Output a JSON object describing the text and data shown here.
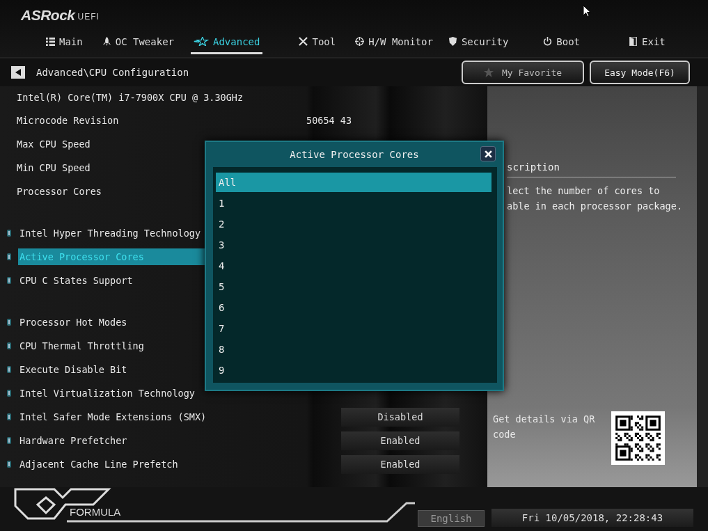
{
  "logo": {
    "brand": "ASRock",
    "suffix": "UEFI"
  },
  "tabs": [
    {
      "label": "Main",
      "selected": false
    },
    {
      "label": "OC Tweaker",
      "selected": false
    },
    {
      "label": "Advanced",
      "selected": true
    },
    {
      "label": "Tool",
      "selected": false
    },
    {
      "label": "H/W Monitor",
      "selected": false
    },
    {
      "label": "Security",
      "selected": false
    },
    {
      "label": "Boot",
      "selected": false
    },
    {
      "label": "Exit",
      "selected": false
    }
  ],
  "breadcrumb": {
    "path": "Advanced\\CPU Configuration"
  },
  "top_buttons": [
    {
      "label": "My Favorite"
    },
    {
      "label": "Easy Mode(F6)"
    }
  ],
  "cpu_name": "Intel(R) Core(TM) i7-7900X CPU @ 3.30GHz",
  "info_rows": [
    {
      "label": "Microcode Revision",
      "value": "50654 43"
    },
    {
      "label": "Max CPU Speed"
    },
    {
      "label": "Min CPU Speed"
    },
    {
      "label": "Processor Cores"
    }
  ],
  "setting_groups": [
    {
      "items": [
        {
          "label": "Intel Hyper Threading Technology",
          "selected": false
        },
        {
          "label": "Active Processor Cores",
          "selected": true
        },
        {
          "label": "CPU C States Support",
          "selected": false
        }
      ]
    },
    {
      "items": [
        {
          "label": "Processor Hot Modes",
          "selected": false
        },
        {
          "label": "CPU Thermal Throttling",
          "selected": false
        },
        {
          "label": "Execute Disable Bit",
          "selected": false
        },
        {
          "label": "Intel Virtualization Technology",
          "selected": false
        },
        {
          "label": "Intel Safer Mode Extensions (SMX)",
          "selected": false,
          "value": "Disabled"
        },
        {
          "label": "Hardware Prefetcher",
          "selected": false,
          "value": "Enabled"
        },
        {
          "label": "Adjacent Cache Line Prefetch",
          "selected": false,
          "value": "Enabled"
        }
      ]
    }
  ],
  "description": {
    "title": "scription",
    "lines": [
      "lect the number of cores to",
      "able in each processor package."
    ]
  },
  "qr": {
    "text": "Get details via QR code"
  },
  "footer": {
    "brand": "FORMULA",
    "language": "English",
    "datetime": "Fri 10/05/2018, 22:28:43"
  },
  "dialog": {
    "title": "Active Processor Cores",
    "options": [
      {
        "label": "All",
        "selected": true
      },
      {
        "label": "1",
        "selected": false
      },
      {
        "label": "2",
        "selected": false
      },
      {
        "label": "3",
        "selected": false
      },
      {
        "label": "4",
        "selected": false
      },
      {
        "label": "5",
        "selected": false
      },
      {
        "label": "6",
        "selected": false
      },
      {
        "label": "7",
        "selected": false
      },
      {
        "label": "8",
        "selected": false
      },
      {
        "label": "9",
        "selected": false
      }
    ]
  }
}
